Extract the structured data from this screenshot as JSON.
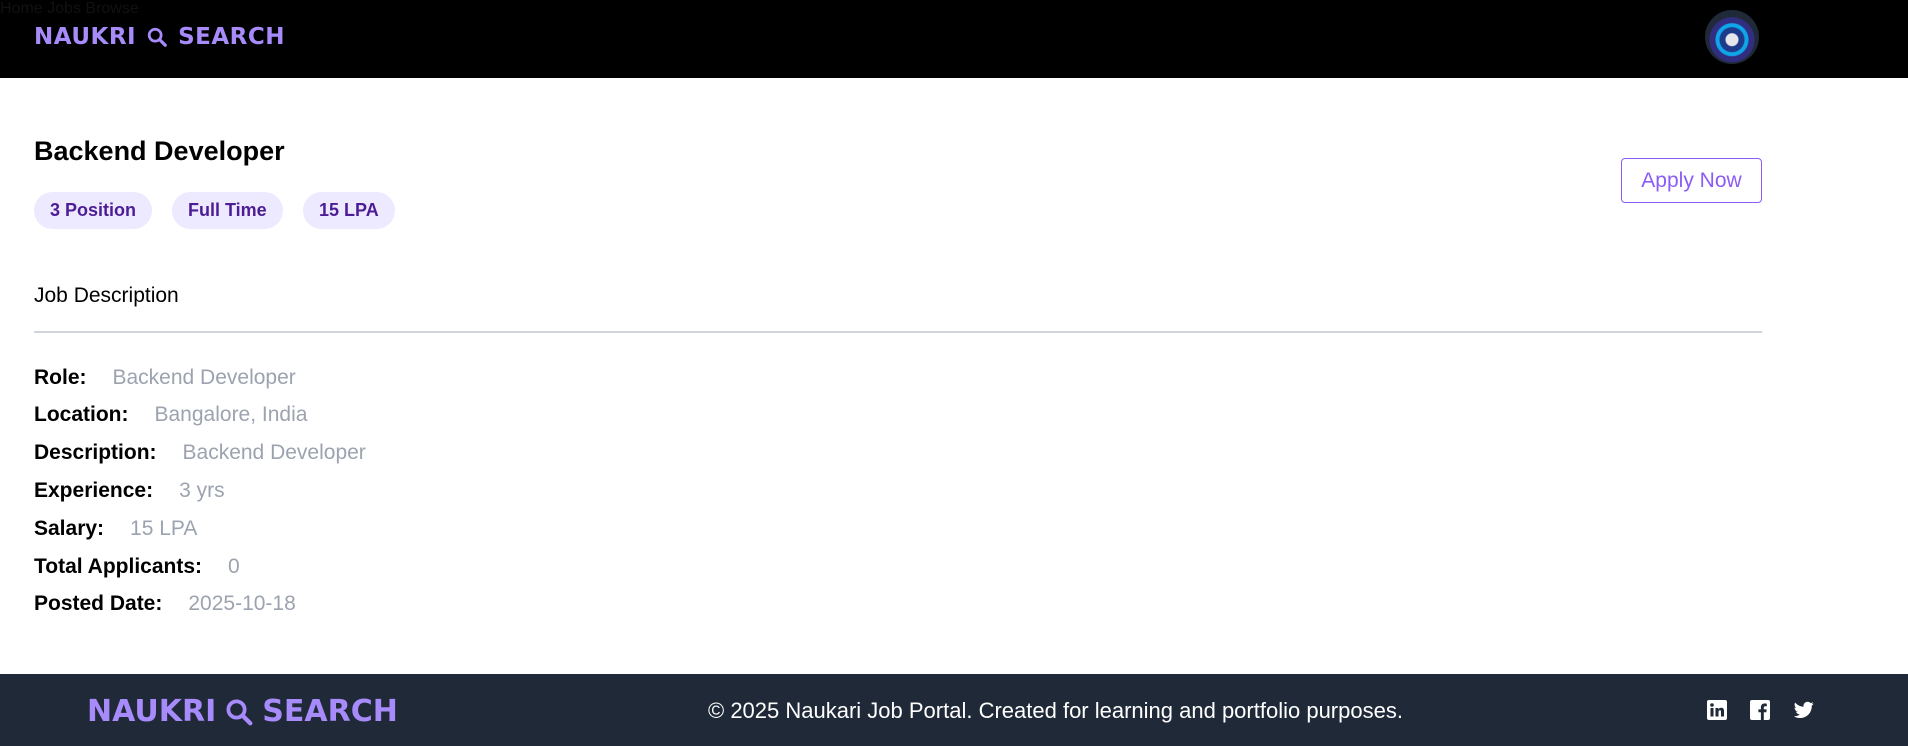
{
  "header": {
    "logo_left": "NAUKRI",
    "logo_right": "SEARCH",
    "nav": [
      {
        "label": "Home"
      },
      {
        "label": "Jobs"
      },
      {
        "label": "Browse"
      }
    ]
  },
  "job": {
    "title": "Backend Developer",
    "badges": [
      "3 Position",
      "Full Time",
      "15 LPA"
    ],
    "apply_label": "Apply Now",
    "section_title": "Job Description",
    "details": [
      {
        "label": "Role:",
        "value": "Backend Developer"
      },
      {
        "label": "Location:",
        "value": "Bangalore, India"
      },
      {
        "label": "Description:",
        "value": "Backend Developer"
      },
      {
        "label": "Experience:",
        "value": "3 yrs"
      },
      {
        "label": "Salary:",
        "value": "15 LPA"
      },
      {
        "label": "Total Applicants:",
        "value": "0"
      },
      {
        "label": "Posted Date:",
        "value": "2025-10-18"
      }
    ]
  },
  "footer": {
    "logo_left": "NAUKRI",
    "logo_right": "SEARCH",
    "copyright": "© 2025 Naukari Job Portal. Created for learning and portfolio purposes.",
    "social_icons": [
      "linkedin-icon",
      "facebook-icon",
      "twitter-icon"
    ]
  },
  "colors": {
    "accent": "#a78bfa",
    "accent_dark": "#8b5cf6",
    "badge_bg": "#ede9fe",
    "badge_text": "#4c1d95",
    "header_bg": "#000000",
    "footer_bg": "#1f2937",
    "muted_text": "#9ca3af"
  }
}
